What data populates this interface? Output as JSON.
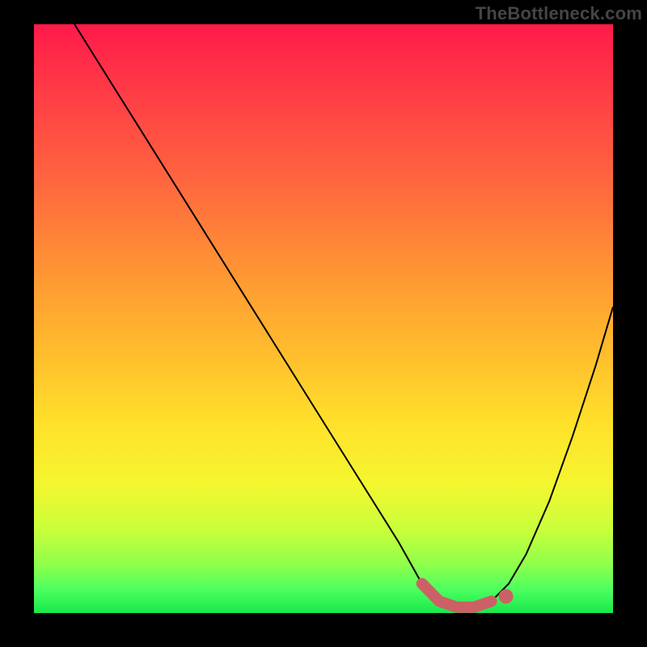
{
  "watermark": "TheBottleneck.com",
  "chart_data": {
    "type": "line",
    "title": "",
    "xlabel": "",
    "ylabel": "",
    "xlim": [
      0,
      100
    ],
    "ylim": [
      0,
      100
    ],
    "series": [
      {
        "name": "bottleneck-curve",
        "x": [
          7,
          14,
          21,
          28,
          35,
          42,
          49,
          56,
          63,
          67,
          70,
          73,
          76,
          79,
          82,
          85,
          89,
          93,
          97,
          100
        ],
        "values": [
          100,
          89,
          78,
          67,
          56,
          45,
          34,
          23,
          12,
          5,
          2,
          1,
          1,
          2,
          5,
          10,
          19,
          30,
          42,
          52
        ]
      }
    ],
    "flat_region_x": [
      67,
      79
    ],
    "gradient_stops": [
      {
        "offset": 0.0,
        "color": "#ff1a4a"
      },
      {
        "offset": 0.12,
        "color": "#ff3d46"
      },
      {
        "offset": 0.28,
        "color": "#ff6a3e"
      },
      {
        "offset": 0.42,
        "color": "#ff9534"
      },
      {
        "offset": 0.55,
        "color": "#ffbb2d"
      },
      {
        "offset": 0.68,
        "color": "#ffe12a"
      },
      {
        "offset": 0.78,
        "color": "#f4f62f"
      },
      {
        "offset": 0.86,
        "color": "#c8ff3b"
      },
      {
        "offset": 0.92,
        "color": "#8cff4c"
      },
      {
        "offset": 0.96,
        "color": "#4dff60"
      },
      {
        "offset": 1.0,
        "color": "#17e84b"
      }
    ],
    "curve_color": "#000000",
    "marker_color": "#cc6066",
    "frame_color": "#000000"
  }
}
